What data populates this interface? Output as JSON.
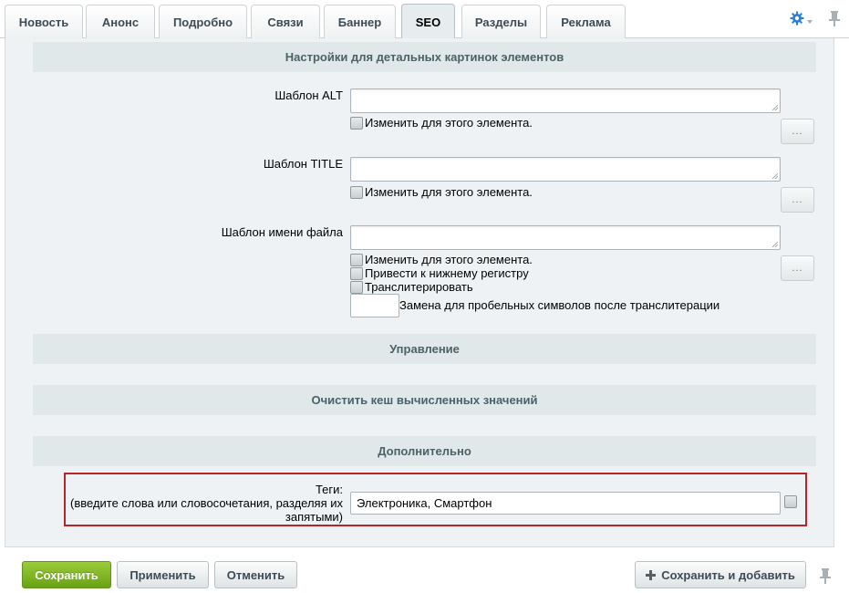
{
  "tabs": [
    {
      "label": "Новость",
      "active": false
    },
    {
      "label": "Анонс",
      "active": false
    },
    {
      "label": "Подробно",
      "active": false
    },
    {
      "label": "Связи",
      "active": false
    },
    {
      "label": "Баннер",
      "active": false
    },
    {
      "label": "SEO",
      "active": true
    },
    {
      "label": "Разделы",
      "active": false
    },
    {
      "label": "Реклама",
      "active": false
    }
  ],
  "icons": {
    "settings": "gear-icon",
    "pin": "pin-icon",
    "add": "plus-icon"
  },
  "colors": {
    "accent_blue": "#2a7fd4",
    "save_green": "#75b11d",
    "highlight_red": "#b3262b",
    "section_bg": "#e0e8ea"
  },
  "detail_images": {
    "heading": "Настройки для детальных картинок элементов",
    "alt_label": "Шаблон ALT",
    "alt_value": "",
    "alt_change": "Изменить для этого элемента.",
    "title_label": "Шаблон TITLE",
    "title_value": "",
    "title_change": "Изменить для этого элемента.",
    "file_label": "Шаблон имени файла",
    "file_value": "",
    "file_change": "Изменить для этого элемента.",
    "lowercase": "Привести к нижнему регистру",
    "transliterate": "Транслитерировать",
    "space_replace_value": "",
    "space_replace_label": "Замена для пробельных символов после транслитерации",
    "dots_label": "..."
  },
  "sections": {
    "management": "Управление",
    "clear_cache": "Очистить кеш вычисленных значений",
    "additional": "Дополнительно"
  },
  "tags": {
    "label_line1": "Теги:",
    "label_line2": "(введите слова или словосочетания, разделяя их",
    "label_line3": "запятыми)",
    "value": "Электроника, Смартфон"
  },
  "footer": {
    "save": "Сохранить",
    "apply": "Применить",
    "cancel": "Отменить",
    "save_add": "Сохранить и добавить"
  }
}
